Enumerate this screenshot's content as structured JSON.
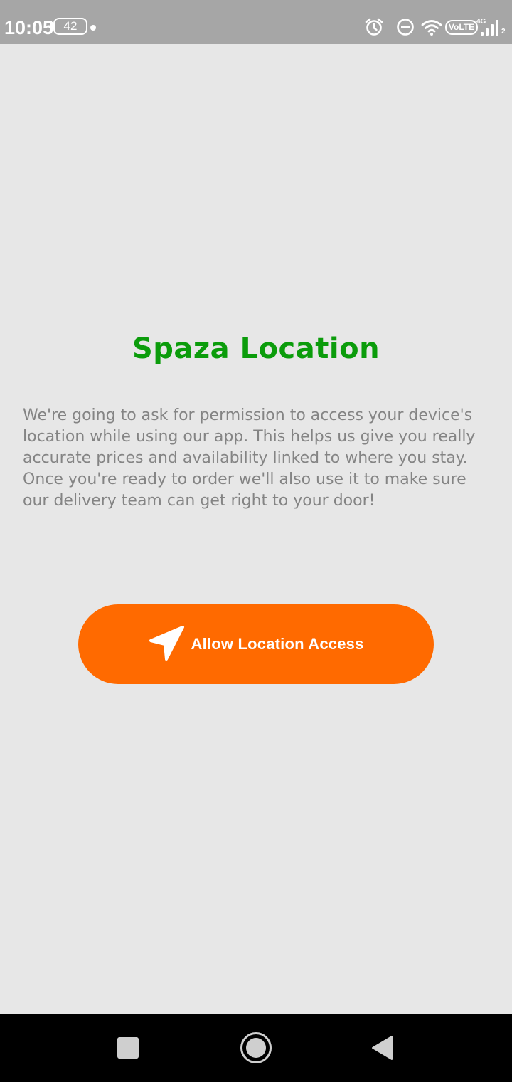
{
  "status_bar": {
    "time": "10:05",
    "battery": "42",
    "network_badge": "VoLTE",
    "network_type": "4G",
    "sim_slot": "2",
    "icons": [
      "alarm-icon",
      "do-not-disturb-icon",
      "wifi-icon",
      "signal-icon"
    ]
  },
  "main": {
    "title": "Spaza Location",
    "description": "We're going to ask for permission to access your device's location while using our app. This helps us give you really accurate prices and availability linked to where you stay. Once you're ready to order we'll also use it to make sure our delivery team can get right to your door!",
    "allow_button_label": "Allow Location Access",
    "allow_button_icon": "navigation-arrow-icon"
  },
  "nav_bar": {
    "icons": [
      "recent-apps-icon",
      "home-icon",
      "back-icon"
    ]
  },
  "colors": {
    "background": "#e7e7e7",
    "status_bar": "#a6a6a6",
    "title": "#0b9c0b",
    "description": "#848484",
    "button": "#ff6a00",
    "nav_bar": "#000000"
  }
}
